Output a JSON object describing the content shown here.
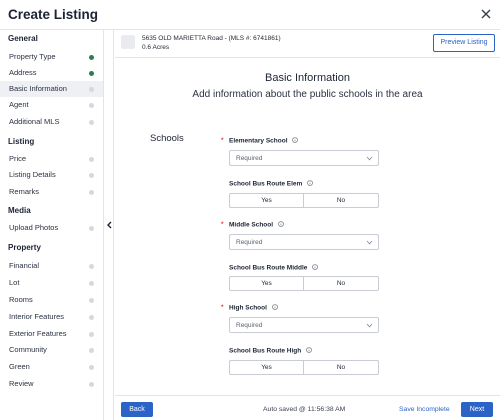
{
  "window": {
    "title": "Create Listing"
  },
  "listing": {
    "address": "5635 OLD MARIETTA Road - (MLS #: 6741861)",
    "acres": "0.6 Acres",
    "preview_label": "Preview Listing"
  },
  "sidebar": {
    "sections": [
      {
        "title": "General",
        "items": [
          {
            "label": "Property Type",
            "status": "done"
          },
          {
            "label": "Address",
            "status": "done"
          },
          {
            "label": "Basic Information",
            "status": "active"
          },
          {
            "label": "Agent",
            "status": "pending"
          },
          {
            "label": "Additional MLS",
            "status": "pending"
          }
        ]
      },
      {
        "title": "Listing",
        "items": [
          {
            "label": "Price",
            "status": "pending"
          },
          {
            "label": "Listing Details",
            "status": "pending"
          },
          {
            "label": "Remarks",
            "status": "pending"
          }
        ]
      },
      {
        "title": "Media",
        "items": [
          {
            "label": "Upload Photos",
            "status": "pending"
          }
        ]
      },
      {
        "title": "Property",
        "items": [
          {
            "label": "Financial",
            "status": "pending"
          },
          {
            "label": "Lot",
            "status": "pending"
          },
          {
            "label": "Rooms",
            "status": "pending"
          },
          {
            "label": "Interior Features",
            "status": "pending"
          },
          {
            "label": "Exterior Features",
            "status": "pending"
          },
          {
            "label": "Community",
            "status": "pending"
          },
          {
            "label": "Green",
            "status": "pending"
          },
          {
            "label": "Review",
            "status": "pending"
          }
        ]
      }
    ]
  },
  "main": {
    "title": "Basic Information",
    "subtitle": "Add information about the public schools in the area",
    "section_label": "Schools",
    "fields": {
      "elementary": {
        "label": "Elementary School",
        "value": "Required"
      },
      "elem_bus": {
        "label": "School Bus Route Elem",
        "yes": "Yes",
        "no": "No"
      },
      "middle": {
        "label": "Middle School",
        "value": "Required"
      },
      "middle_bus": {
        "label": "School Bus Route Middle",
        "yes": "Yes",
        "no": "No"
      },
      "high": {
        "label": "High School",
        "value": "Required"
      },
      "high_bus": {
        "label": "School Bus Route High",
        "yes": "Yes",
        "no": "No"
      }
    }
  },
  "footer": {
    "back_label": "Back",
    "autosave_text": "Auto saved @ 11:56:38 AM",
    "save_incomplete_label": "Save Incomplete",
    "next_label": "Next"
  },
  "colors": {
    "accent": "#2b63c7",
    "done": "#2e7d52",
    "pending": "#d5d8dd",
    "required": "#d93c3c"
  }
}
